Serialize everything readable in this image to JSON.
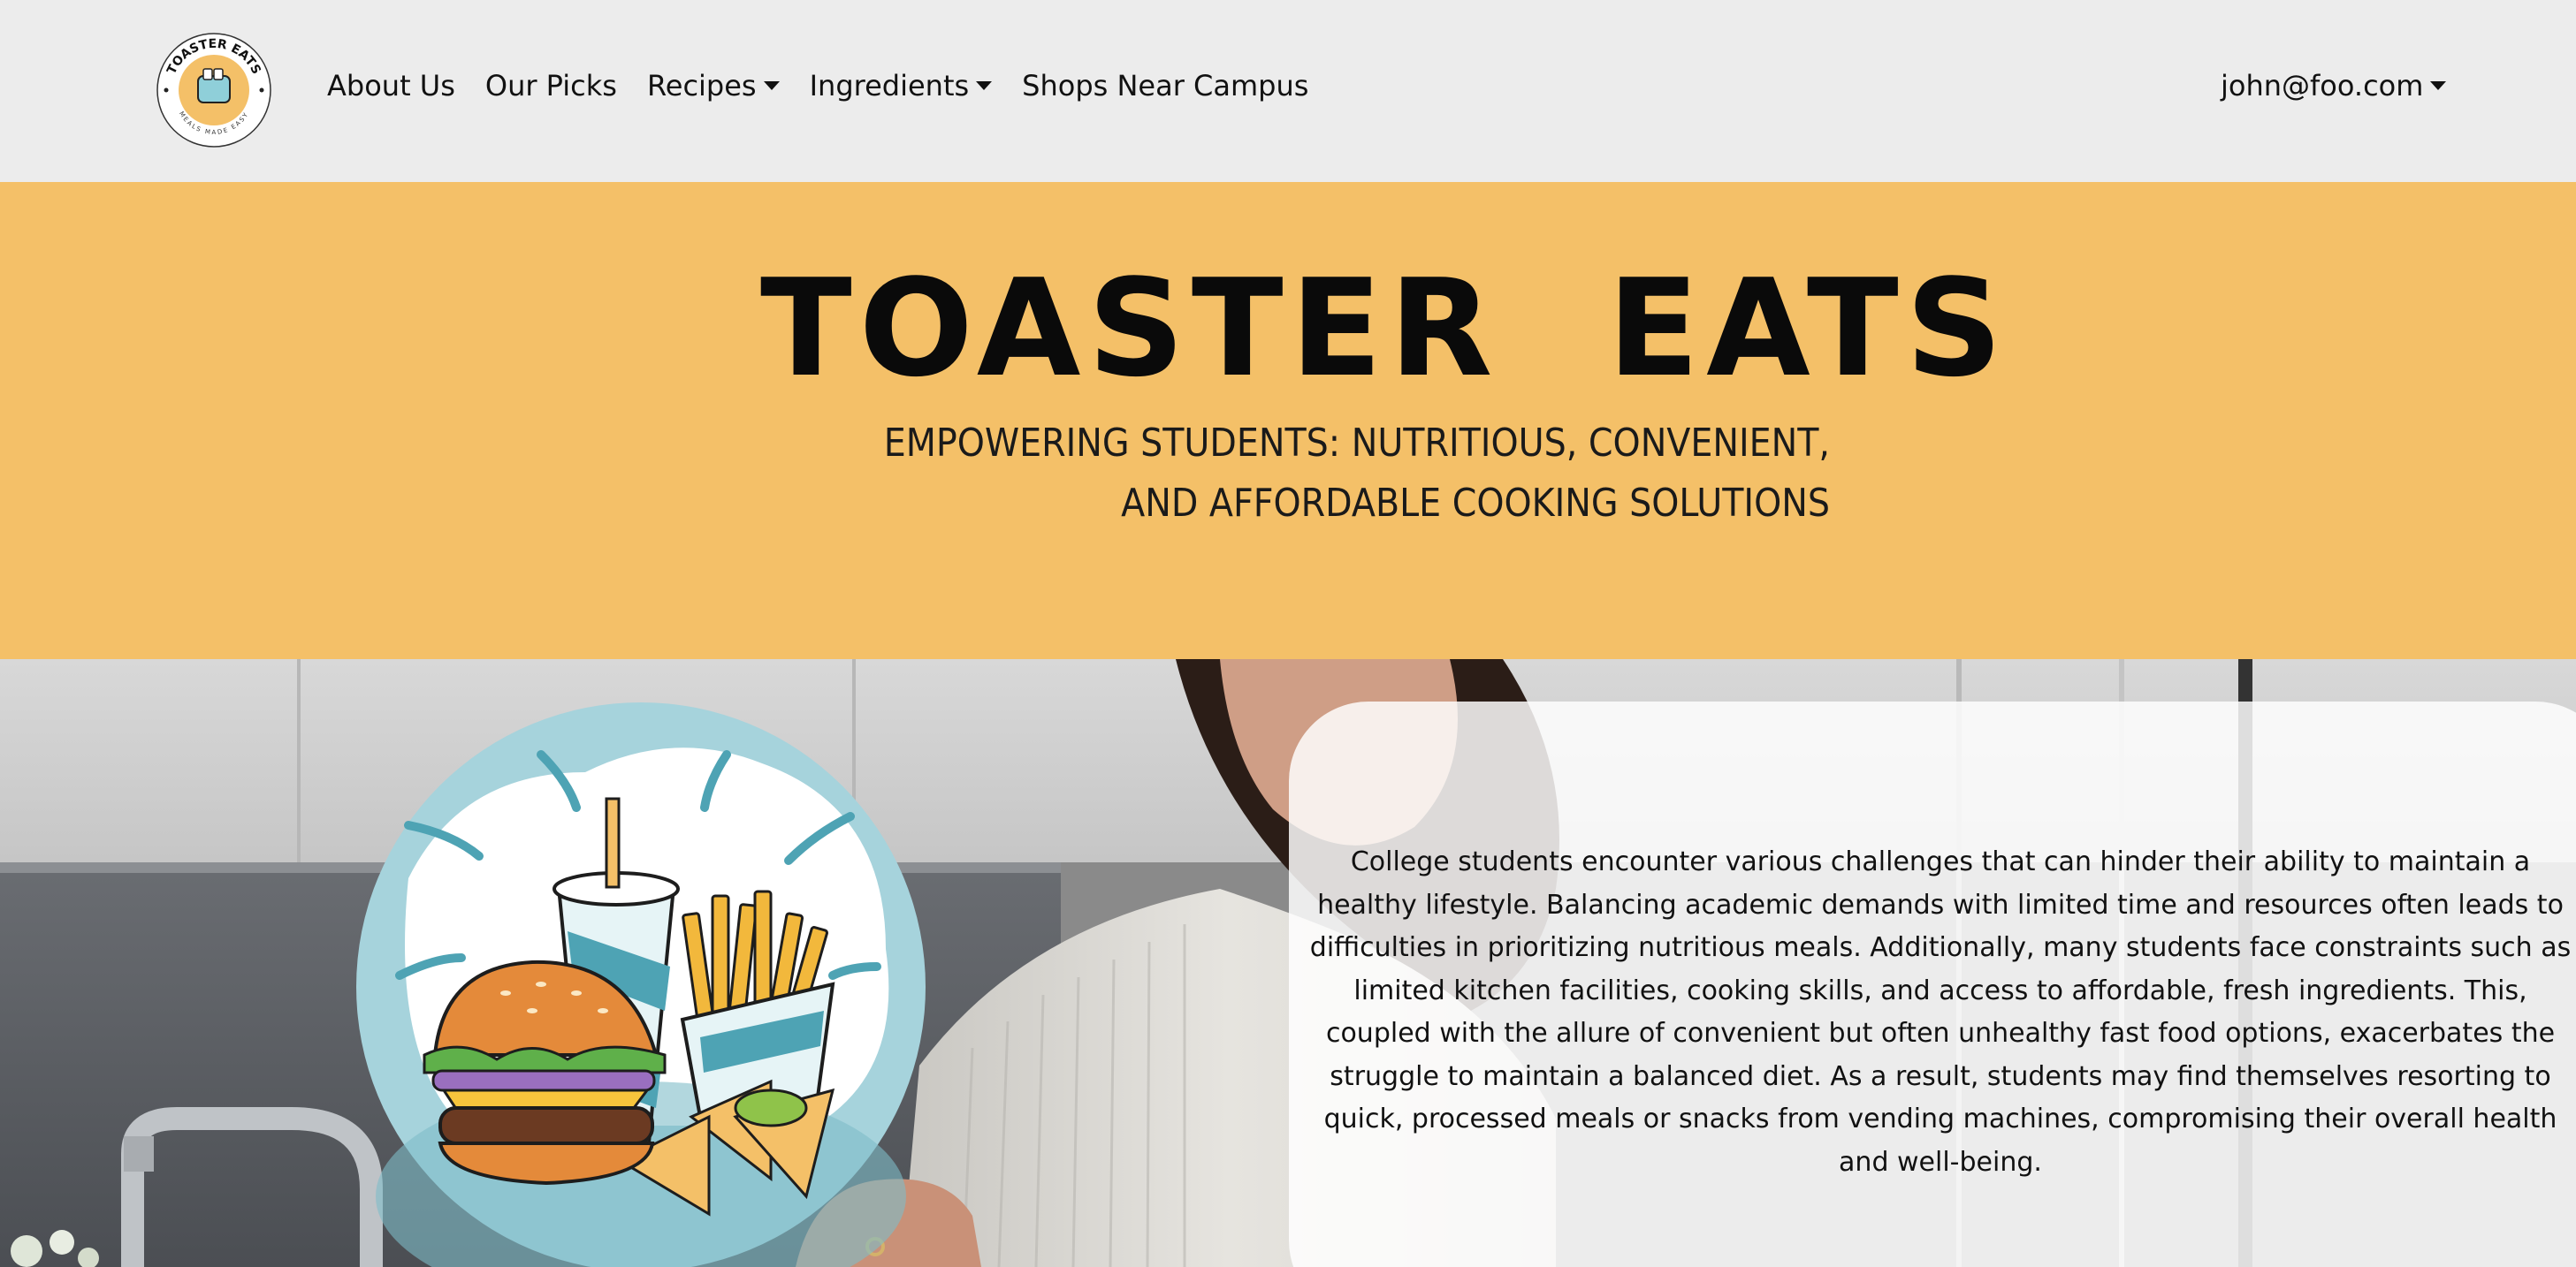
{
  "brand": {
    "logo_text": "TOASTER EATS",
    "logo_tagline": "MEALS MADE EASY"
  },
  "nav": {
    "items": [
      {
        "label": "About Us",
        "dropdown": false
      },
      {
        "label": "Our Picks",
        "dropdown": false
      },
      {
        "label": "Recipes",
        "dropdown": true
      },
      {
        "label": "Ingredients",
        "dropdown": true
      },
      {
        "label": "Shops Near Campus",
        "dropdown": false
      }
    ],
    "user": "john@foo.com"
  },
  "hero": {
    "title": "TOASTER  EATS",
    "subtitle_line1": "EMPOWERING STUDENTS: NUTRITIOUS, CONVENIENT,",
    "subtitle_line2": "AND AFFORDABLE COOKING SOLUTIONS"
  },
  "intro": {
    "text": "College students encounter various challenges that can hinder their ability to maintain a healthy lifestyle. Balancing academic demands with limited time and resources often leads to difficulties in prioritizing nutritious meals. Additionally, many students face constraints such as limited kitchen facilities, cooking skills, and access to affordable, fresh ingredients. This, coupled with the allure of convenient but often unhealthy fast food options, exacerbates the struggle to maintain a balanced diet. As a result, students may find themselves resorting to quick, processed meals or snacks from vending machines, compromising their overall health and well-being."
  },
  "colors": {
    "hero_bg": "#f4c068",
    "nav_bg": "#ececec",
    "illustration_teal": "#a6d3dc"
  },
  "icons": {
    "logo": "toaster-logo-icon",
    "caret": "caret-down-icon",
    "illustration": "fast-food-illustration"
  }
}
